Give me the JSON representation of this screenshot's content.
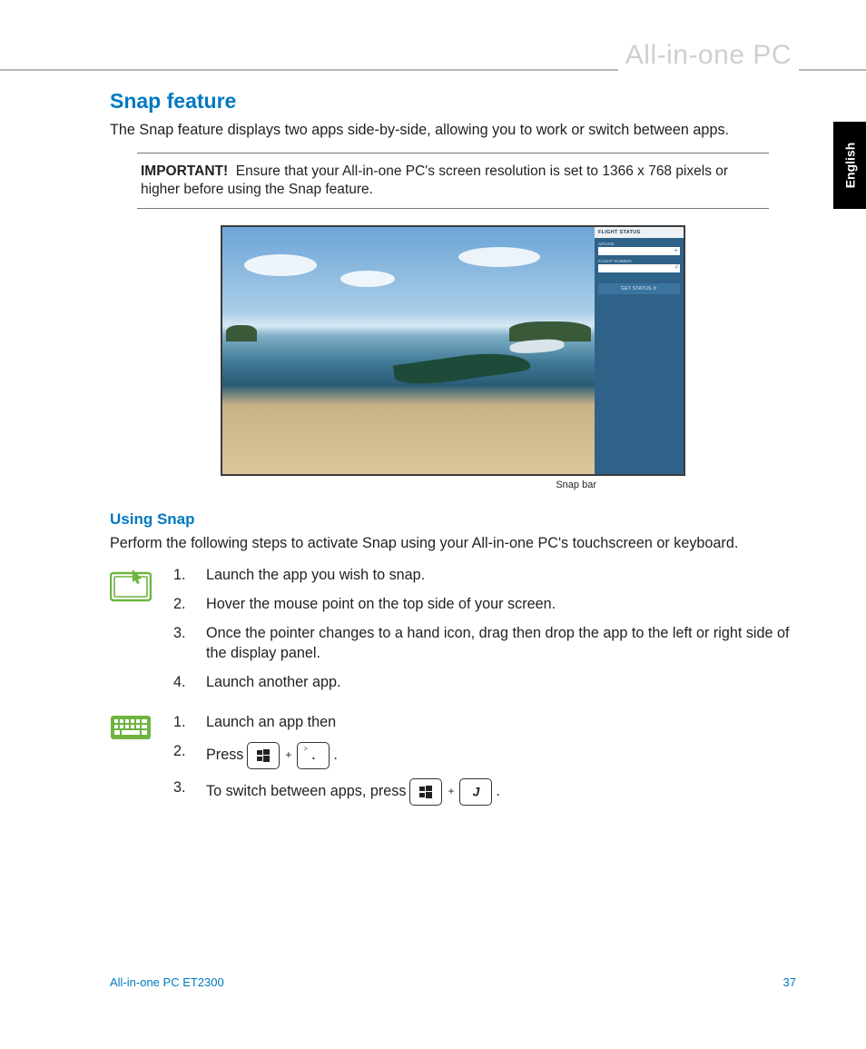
{
  "header": {
    "product_line": "All-in-one PC"
  },
  "side_tab": {
    "language": "English"
  },
  "section": {
    "title": "Snap feature",
    "intro": "The Snap feature displays two apps side-by-side, allowing you to work or switch between apps."
  },
  "important_note": {
    "label": "IMPORTANT!",
    "text": "Ensure that your All-in-one PC's screen resolution is set to 1366 x 768 pixels or higher before using the Snap feature."
  },
  "screenshot": {
    "app_panel": {
      "title": "FLIGHT STATUS",
      "field1_label": "AIRLINE",
      "field2_label": "FLIGHT NUMBER",
      "button": "GET STATUS",
      "close": "×"
    },
    "caption": "Snap bar"
  },
  "using_snap": {
    "title": "Using Snap",
    "intro": "Perform the following steps to activate Snap using your All-in-one PC's touchscreen or keyboard.",
    "touch_steps": [
      "Launch the app you wish to snap.",
      "Hover the mouse point on the top side of your screen.",
      "Once the pointer changes to a hand icon, drag then drop the app to the left or right side of the display panel.",
      "Launch another app."
    ],
    "keyboard_steps": {
      "step1": "Launch an app then",
      "step2_prefix": "Press",
      "step2_suffix": ".",
      "step3_prefix": "To switch between apps, press",
      "step3_suffix": ".",
      "plus": "+",
      "period_sup": ">",
      "period_dot": ".",
      "j_key": "J"
    }
  },
  "footer": {
    "product": "All-in-one PC ET2300",
    "page": "37"
  }
}
